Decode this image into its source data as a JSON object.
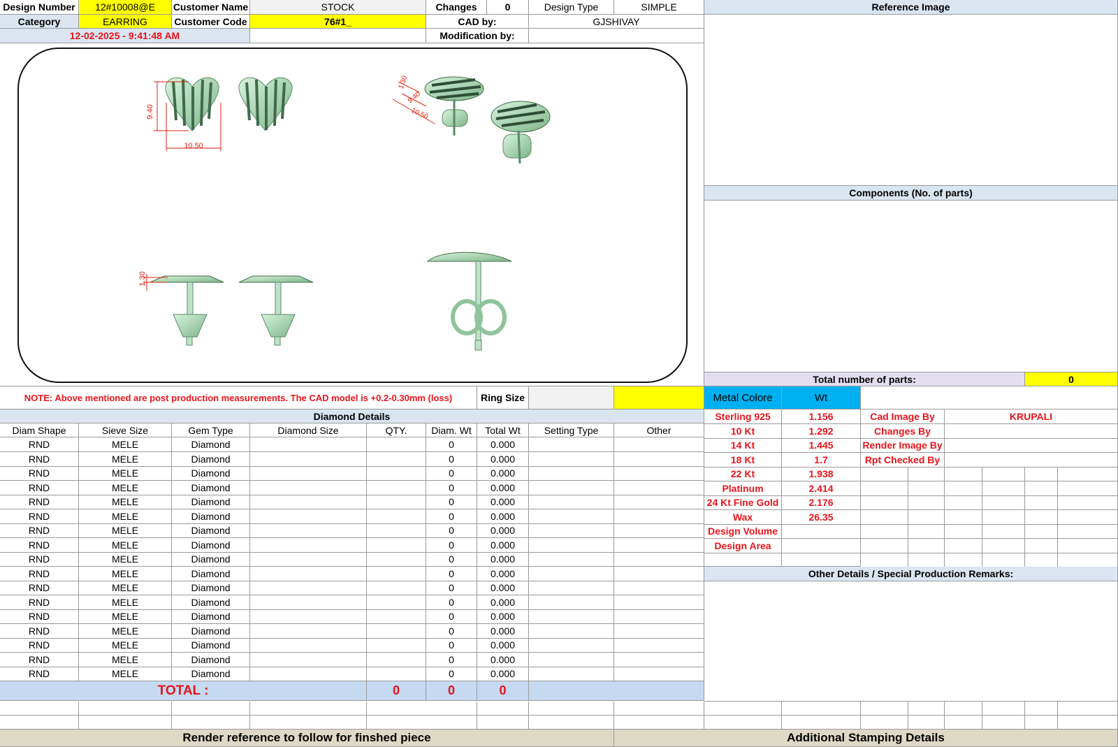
{
  "header": {
    "design_number_label": "Design Number",
    "design_number": "12#10008@E",
    "customer_name_label": "Customer Name",
    "customer_name": "STOCK",
    "changes_label": "Changes",
    "changes": "0",
    "design_type_label": "Design Type",
    "design_type": "SIMPLE",
    "category_label": "Category",
    "category": "EARRING",
    "customer_code_label": "Customer Code",
    "customer_code": "76#1_",
    "cad_by_label": "CAD by:",
    "cad_by": "GJSHIVAY",
    "timestamp": "12-02-2025 - 9:41:48 AM",
    "modification_label": "Modification by:"
  },
  "drawing": {
    "dim_width": "10.50",
    "dim_height": "9.40",
    "dim_thickness": "1.30",
    "dim_side_a": "1.30",
    "dim_side_b": "9.40",
    "dim_side_c": "10.50"
  },
  "note": "NOTE: Above mentioned are post production measurements. The CAD model is +0.2-0.30mm (loss)",
  "ring_size_label": "Ring Size",
  "right": {
    "reference_image": "Reference Image",
    "components": "Components (No. of parts)",
    "total_parts_label": "Total number of parts:",
    "total_parts": "0",
    "other_details": "Other Details / Special Production Remarks:",
    "additional_stamping": "Additional Stamping Details"
  },
  "metal": {
    "header_color": "Metal Colore",
    "header_wt": "Wt",
    "rows": [
      {
        "name": "Sterling 925",
        "wt": "1.156"
      },
      {
        "name": "10 Kt",
        "wt": "1.292"
      },
      {
        "name": "14 Kt",
        "wt": "1.445"
      },
      {
        "name": "18 Kt",
        "wt": "1.7"
      },
      {
        "name": "22 Kt",
        "wt": "1.938"
      },
      {
        "name": "Platinum",
        "wt": "2.414"
      },
      {
        "name": "24 Kt Fine Gold",
        "wt": "2.176"
      },
      {
        "name": "Wax",
        "wt": "26.35"
      },
      {
        "name": "Design Volume",
        "wt": ""
      },
      {
        "name": "Design Area",
        "wt": ""
      }
    ]
  },
  "credits": [
    {
      "label": "Cad Image By",
      "value": "KRUPALI"
    },
    {
      "label": "Changes By",
      "value": ""
    },
    {
      "label": "Render Image By",
      "value": ""
    },
    {
      "label": "Rpt Checked By",
      "value": ""
    }
  ],
  "diamond": {
    "title": "Diamond Details",
    "columns": [
      "Diam Shape",
      "Sieve Size",
      "Gem Type",
      "Diamond Size",
      "QTY.",
      "Diam. Wt",
      "Total Wt",
      "Setting Type",
      "Other"
    ],
    "rows": [
      [
        "RND",
        "MELE",
        "Diamond",
        "",
        "",
        "0",
        "0.000",
        "",
        ""
      ],
      [
        "RND",
        "MELE",
        "Diamond",
        "",
        "",
        "0",
        "0.000",
        "",
        ""
      ],
      [
        "RND",
        "MELE",
        "Diamond",
        "",
        "",
        "0",
        "0.000",
        "",
        ""
      ],
      [
        "RND",
        "MELE",
        "Diamond",
        "",
        "",
        "0",
        "0.000",
        "",
        ""
      ],
      [
        "RND",
        "MELE",
        "Diamond",
        "",
        "",
        "0",
        "0.000",
        "",
        ""
      ],
      [
        "RND",
        "MELE",
        "Diamond",
        "",
        "",
        "0",
        "0.000",
        "",
        ""
      ],
      [
        "RND",
        "MELE",
        "Diamond",
        "",
        "",
        "0",
        "0.000",
        "",
        ""
      ],
      [
        "RND",
        "MELE",
        "Diamond",
        "",
        "",
        "0",
        "0.000",
        "",
        ""
      ],
      [
        "RND",
        "MELE",
        "Diamond",
        "",
        "",
        "0",
        "0.000",
        "",
        ""
      ],
      [
        "RND",
        "MELE",
        "Diamond",
        "",
        "",
        "0",
        "0.000",
        "",
        ""
      ],
      [
        "RND",
        "MELE",
        "Diamond",
        "",
        "",
        "0",
        "0.000",
        "",
        ""
      ],
      [
        "RND",
        "MELE",
        "Diamond",
        "",
        "",
        "0",
        "0.000",
        "",
        ""
      ],
      [
        "RND",
        "MELE",
        "Diamond",
        "",
        "",
        "0",
        "0.000",
        "",
        ""
      ],
      [
        "RND",
        "MELE",
        "Diamond",
        "",
        "",
        "0",
        "0.000",
        "",
        ""
      ],
      [
        "RND",
        "MELE",
        "Diamond",
        "",
        "",
        "0",
        "0.000",
        "",
        ""
      ],
      [
        "RND",
        "MELE",
        "Diamond",
        "",
        "",
        "0",
        "0.000",
        "",
        ""
      ],
      [
        "RND",
        "MELE",
        "Diamond",
        "",
        "",
        "0",
        "0.000",
        "",
        ""
      ]
    ],
    "total_label": "TOTAL :",
    "total_qty": "0",
    "total_diam_wt": "0",
    "total_wt": "0"
  },
  "footer": {
    "render_reference": "Render reference to follow for finshed piece"
  }
}
